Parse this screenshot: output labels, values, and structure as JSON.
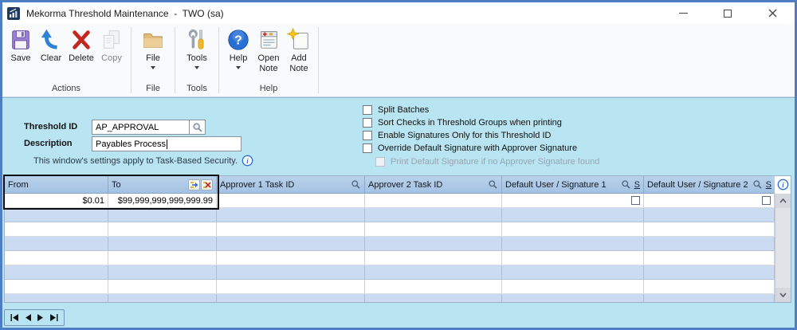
{
  "window": {
    "title": "Mekorma Threshold Maintenance  -  TWO (sa)"
  },
  "ribbon": {
    "buttons": [
      {
        "label": "Save"
      },
      {
        "label": "Clear"
      },
      {
        "label": "Delete"
      },
      {
        "label": "Copy"
      },
      {
        "label": "File"
      },
      {
        "label": "Tools"
      },
      {
        "label": "Help"
      },
      {
        "label": "Open\nNote"
      },
      {
        "label": "Add\nNote"
      }
    ],
    "groups": [
      {
        "label": "Actions"
      },
      {
        "label": "File"
      },
      {
        "label": "Tools"
      },
      {
        "label": "Help"
      }
    ]
  },
  "form": {
    "threshold_id": {
      "label": "Threshold ID",
      "value": "AP_APPROVAL"
    },
    "description": {
      "label": "Description",
      "value": "Payables Process"
    },
    "security_note": "This window's settings apply to Task-Based Security.",
    "checkboxes": [
      {
        "label": "Split Batches",
        "checked": false
      },
      {
        "label": "Sort Checks in Threshold Groups when printing",
        "checked": false
      },
      {
        "label": "Enable Signatures Only for this Threshold ID",
        "checked": false
      },
      {
        "label": "Override Default Signature with Approver Signature",
        "checked": false
      },
      {
        "label": "Print Default Signature if no Approver Signature found",
        "checked": false,
        "disabled": true
      }
    ]
  },
  "table": {
    "columns": [
      {
        "label": "From"
      },
      {
        "label": "To"
      },
      {
        "label": "Approver 1 Task ID"
      },
      {
        "label": "Approver 2 Task ID"
      },
      {
        "label": "Default User / Signature 1",
        "s": "S"
      },
      {
        "label": "Default User / Signature 2",
        "s": "S"
      }
    ],
    "rows": [
      {
        "from": "$0.01",
        "to": "$99,999,999,999,999.99"
      }
    ]
  },
  "colors": {
    "accent_border": "#4d7ec4",
    "content_bg": "#b9e4f1",
    "grid_header_bg": "#aac7e6",
    "grid_alt_row": "#cbdcf2"
  }
}
